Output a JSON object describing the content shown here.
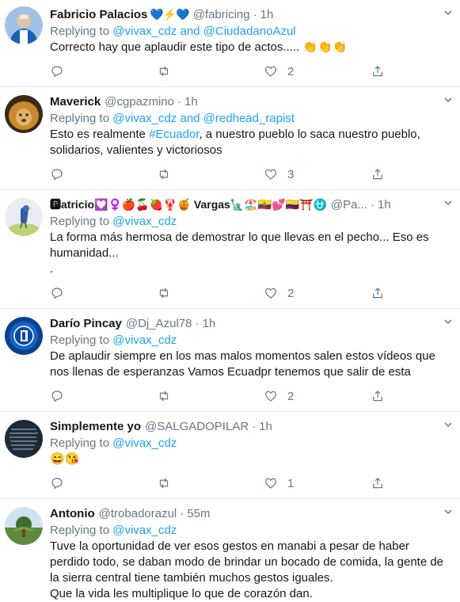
{
  "tweets": [
    {
      "name": "Fabricio Palacios",
      "name_emojis": "💙⚡💙",
      "handle": "@fabricing",
      "time": "1h",
      "reply_prefix": "Replying to",
      "reply_mentions": "@vivax_cdz and @CiudadanoAzul",
      "text": "Correcto hay que aplaudir este tipo de actos..... 👏👏👏",
      "likes": "2"
    },
    {
      "name": "Maverick",
      "handle": "@cgpazmino",
      "time": "1h",
      "reply_prefix": "Replying to",
      "reply_mentions": "@vivax_cdz and @redhead_rapist",
      "text_pre": "Esto es realmente ",
      "hashtag": "#Ecuador",
      "text_post": ", a nuestro pueblo lo saca nuestro pueblo, solidarios, valientes y victoriosos",
      "likes": "3"
    },
    {
      "name": "🅿atricio💟♀️🍎🍒🍓🦞🍯 Vargas🗽🏖️🇪🇨💕🇨🇴⛩️⛎",
      "handle": "@Pa...",
      "time": "1h",
      "reply_prefix": "Replying to",
      "reply_mentions": "@vivax_cdz",
      "text": "La forma más hermosa de demostrar lo que llevas en el pecho... Eso es humanidad...\n.",
      "likes": "2"
    },
    {
      "name": "Darío Pincay",
      "handle": "@Dj_Azul78",
      "time": "1h",
      "reply_prefix": "Replying to",
      "reply_mentions": "@vivax_cdz",
      "text": "De aplaudir siempre en los mas malos momentos salen estos vídeos que nos llenas de esperanzas Vamos Ecuadpr tenemos que salir de esta",
      "likes": "2"
    },
    {
      "name": "Simplemente yo",
      "handle": "@SALGADOPILAR",
      "time": "1h",
      "reply_prefix": "Replying to",
      "reply_mentions": "@vivax_cdz",
      "text": "😄😘",
      "likes": "1"
    },
    {
      "name": "Antonio",
      "handle": "@trobadorazul",
      "time": "55m",
      "reply_prefix": "Replying to",
      "reply_mentions": "@vivax_cdz",
      "text": "Tuve la oportunidad de ver esos gestos en manabi a pesar de haber perdido todo, se daban modo de brindar un bocado de comida, la gente de la sierra central tiene también muchos gestos iguales.\nQue la vida les multiplique lo que de corazón dan."
    }
  ],
  "separator": "·",
  "colors": {
    "accent": "#1da1f2",
    "muted": "#657786",
    "border": "#e6ecf0"
  },
  "icons": [
    "reply-icon",
    "retweet-icon",
    "like-icon",
    "share-icon",
    "chevron-down-icon"
  ]
}
